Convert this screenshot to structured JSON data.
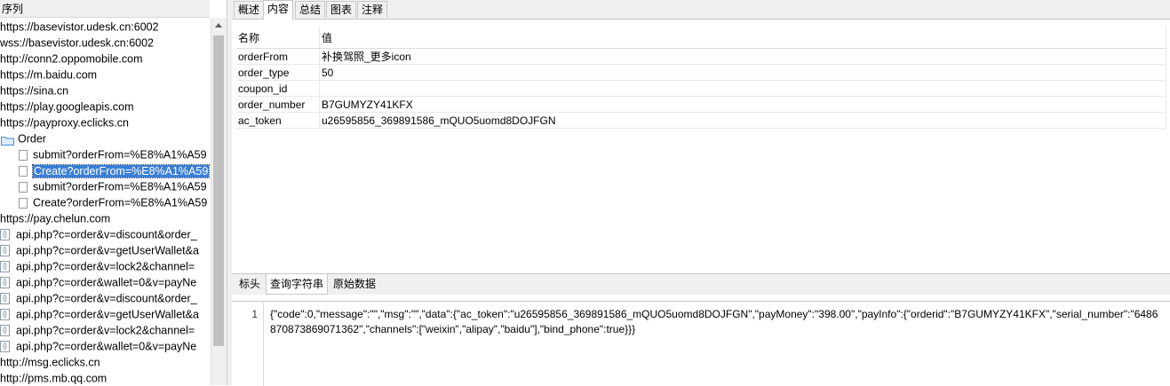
{
  "left_panel": {
    "header": "序列",
    "tree": [
      {
        "label": "https://basevistor.udesk.cn:6002",
        "type": "host"
      },
      {
        "label": "wss://basevistor.udesk.cn:6002",
        "type": "host"
      },
      {
        "label": "http://conn2.oppomobile.com",
        "type": "host"
      },
      {
        "label": "https://m.baidu.com",
        "type": "host"
      },
      {
        "label": "https://sina.cn",
        "type": "host"
      },
      {
        "label": "https://play.googleapis.com",
        "type": "host"
      },
      {
        "label": "https://payproxy.eclicks.cn",
        "type": "host"
      },
      {
        "label": "Order",
        "type": "folder"
      },
      {
        "label": "submit?orderFrom=%E8%A1%A59",
        "type": "file"
      },
      {
        "label": "Create?orderFrom=%E8%A1%A59",
        "type": "file",
        "selected": true
      },
      {
        "label": "submit?orderFrom=%E8%A1%A59",
        "type": "file"
      },
      {
        "label": "Create?orderFrom=%E8%A1%A59",
        "type": "file"
      },
      {
        "label": "https://pay.chelun.com",
        "type": "host"
      },
      {
        "label": "api.php?c=order&v=discount&order_",
        "type": "api"
      },
      {
        "label": "api.php?c=order&v=getUserWallet&a",
        "type": "api"
      },
      {
        "label": "api.php?c=order&v=lock2&channel=",
        "type": "api"
      },
      {
        "label": "api.php?c=order&wallet=0&v=payNe",
        "type": "api"
      },
      {
        "label": "api.php?c=order&v=discount&order_",
        "type": "api"
      },
      {
        "label": "api.php?c=order&v=getUserWallet&a",
        "type": "api"
      },
      {
        "label": "api.php?c=order&v=lock2&channel=",
        "type": "api"
      },
      {
        "label": "api.php?c=order&wallet=0&v=payNe",
        "type": "api"
      },
      {
        "label": "http://msg.eclicks.cn",
        "type": "host"
      },
      {
        "label": "http://pms.mb.qq.com",
        "type": "host"
      }
    ]
  },
  "top_tabs": [
    "概述",
    "内容",
    "总结",
    "图表",
    "注释"
  ],
  "active_top_tab": 1,
  "table": {
    "headers": [
      "名称",
      "值"
    ],
    "rows": [
      [
        "orderFrom",
        "补换驾照_更多icon"
      ],
      [
        "order_type",
        "50"
      ],
      [
        "coupon_id",
        ""
      ],
      [
        "order_number",
        "B7GUMYZY41KFX"
      ],
      [
        "ac_token",
        "u26595856_369891586_mQUO5uomd8DOJFGN"
      ]
    ]
  },
  "mid_tabs": [
    "标头",
    "查询字符串",
    "原始数据"
  ],
  "active_mid_tab": 1,
  "raw": {
    "line_number": "1",
    "text": "{\"code\":0,\"message\":\"\",\"msg\":\"\",\"data\":{\"ac_token\":\"u26595856_369891586_mQUO5uomd8DOJFGN\",\"payMoney\":\"398.00\",\"payInfo\":{\"orderid\":\"B7GUMYZY41KFX\",\"serial_number\":\"6486870873869071362\",\"channels\":[\"weixin\",\"alipay\",\"baidu\"],\"bind_phone\":true}}}"
  }
}
